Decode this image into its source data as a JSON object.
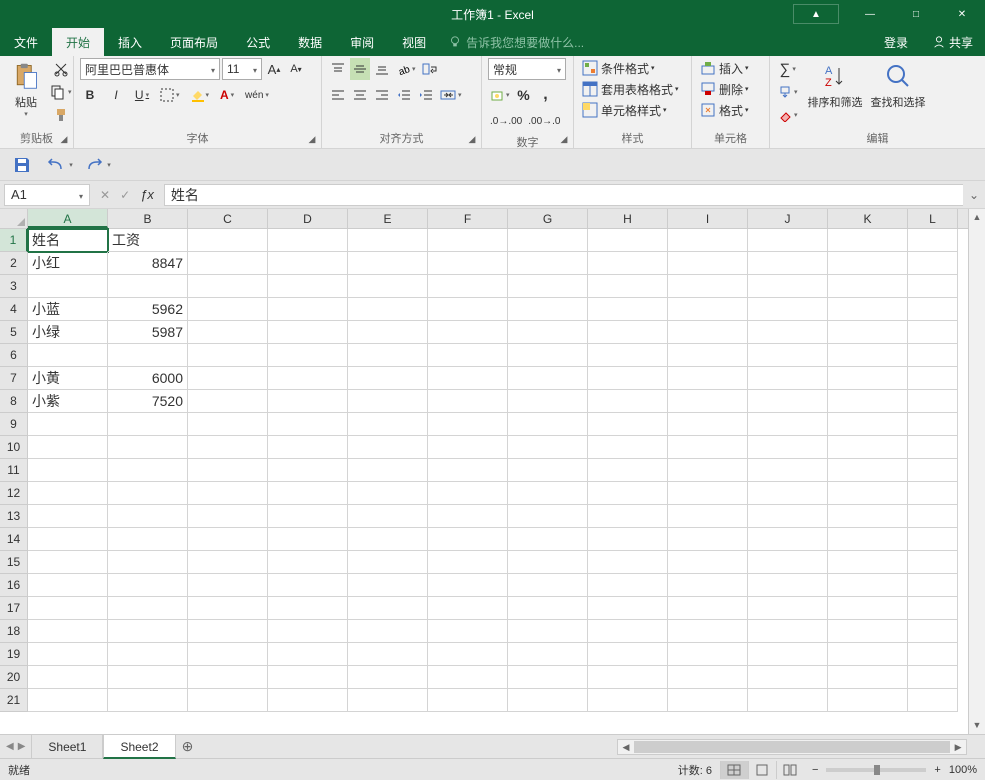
{
  "title": "工作簿1 - Excel",
  "win_controls": {
    "minimize": "—",
    "maximize": "□",
    "close": "✕"
  },
  "tabs": {
    "file": "文件",
    "home": "开始",
    "insert": "插入",
    "page_layout": "页面布局",
    "formulas": "公式",
    "data": "数据",
    "review": "审阅",
    "view": "视图"
  },
  "tell_me": "告诉我您想要做什么...",
  "account": {
    "login": "登录",
    "share": "共享"
  },
  "ribbon": {
    "clipboard": {
      "paste": "粘贴",
      "label": "剪贴板"
    },
    "font": {
      "name": "阿里巴巴普惠体",
      "size": "11",
      "bold": "B",
      "italic": "I",
      "underline": "U",
      "label": "字体",
      "pinyin": "wén"
    },
    "alignment": {
      "label": "对齐方式"
    },
    "number": {
      "format": "常规",
      "label": "数字"
    },
    "styles": {
      "cond": "条件格式",
      "table": "套用表格格式",
      "cell": "单元格样式",
      "label": "样式"
    },
    "cells": {
      "insert": "插入",
      "delete": "删除",
      "format": "格式",
      "label": "单元格"
    },
    "editing": {
      "sort": "排序和筛选",
      "find": "查找和选择",
      "label": "编辑"
    }
  },
  "name_box": "A1",
  "formula": "姓名",
  "columns": [
    "A",
    "B",
    "C",
    "D",
    "E",
    "F",
    "G",
    "H",
    "I",
    "J",
    "K",
    "L"
  ],
  "rows": [
    1,
    2,
    3,
    4,
    5,
    6,
    7,
    8,
    9,
    10,
    11,
    12,
    13,
    14,
    15,
    16,
    17,
    18,
    19,
    20,
    21
  ],
  "grid": {
    "r1": {
      "A": "姓名",
      "B": "工资"
    },
    "r2": {
      "A": "小红",
      "B": 8847
    },
    "r3": {},
    "r4": {
      "A": "小蓝",
      "B": 5962
    },
    "r5": {
      "A": "小绿",
      "B": 5987
    },
    "r6": {},
    "r7": {
      "A": "小黄",
      "B": 6000
    },
    "r8": {
      "A": "小紫",
      "B": 7520
    }
  },
  "sheets": {
    "s1": "Sheet1",
    "s2": "Sheet2"
  },
  "status": {
    "ready": "就绪",
    "count": "计数: 6",
    "zoom": "100%"
  }
}
